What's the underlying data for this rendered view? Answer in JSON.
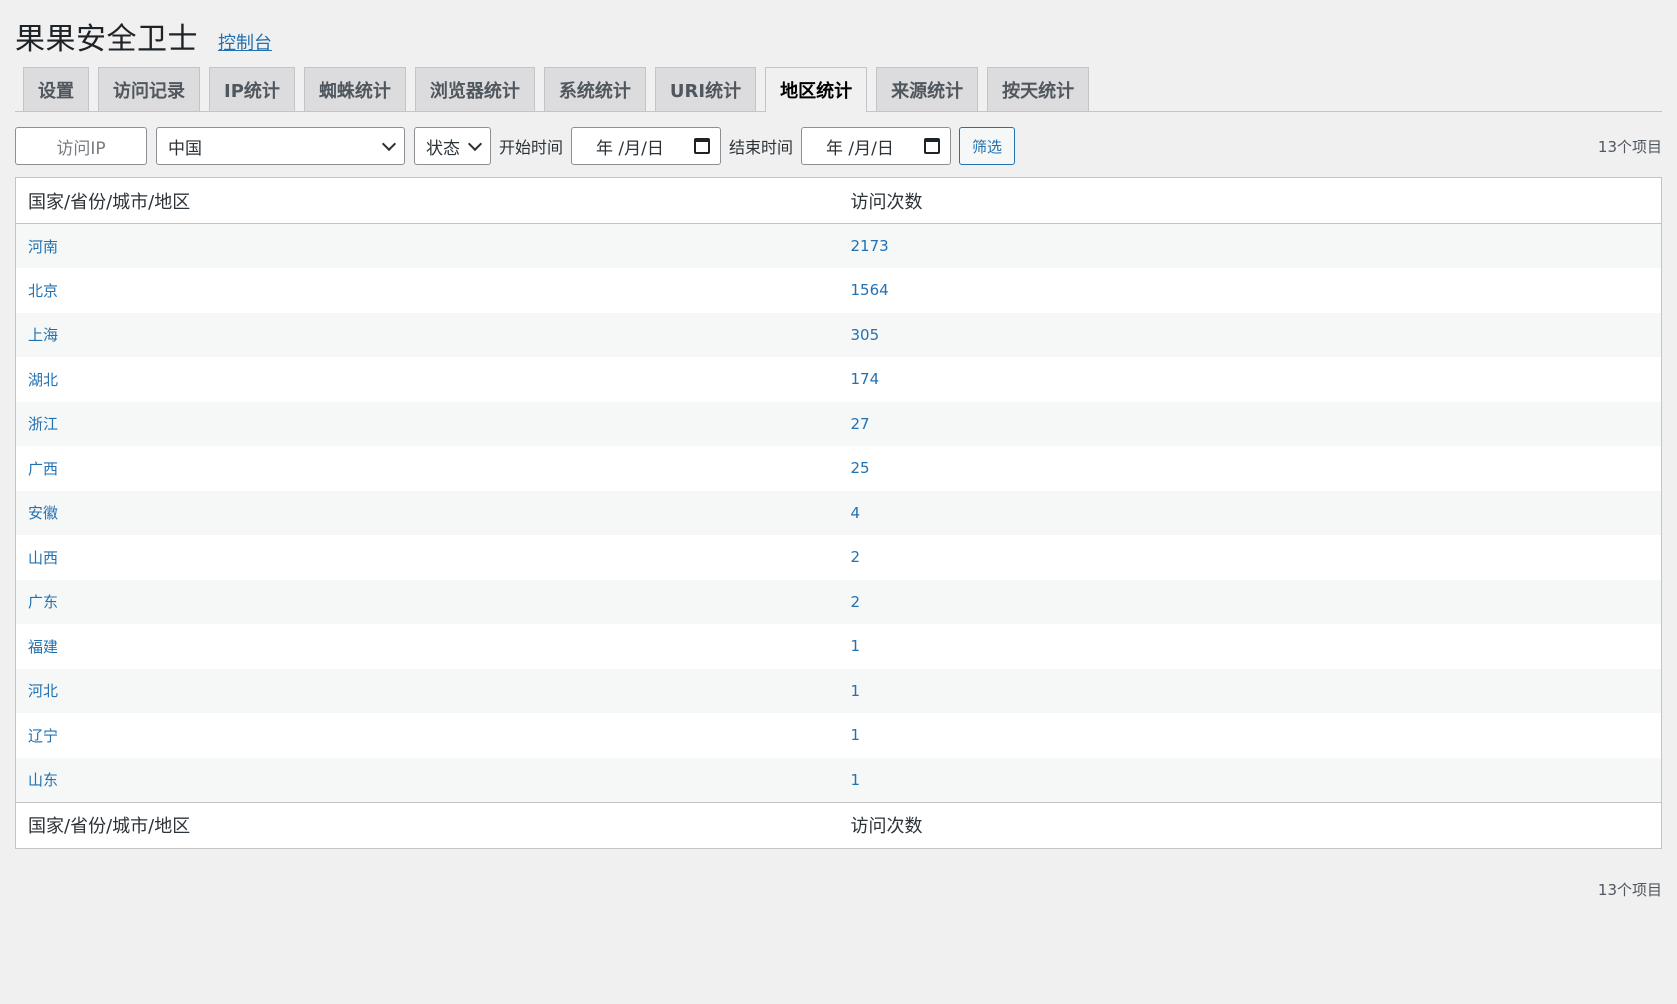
{
  "header": {
    "title": "果果安全卫士",
    "console_link": "控制台"
  },
  "tabs": [
    {
      "label": "设置",
      "active": false
    },
    {
      "label": "访问记录",
      "active": false
    },
    {
      "label": "IP统计",
      "active": false
    },
    {
      "label": "蜘蛛统计",
      "active": false
    },
    {
      "label": "浏览器统计",
      "active": false
    },
    {
      "label": "系统统计",
      "active": false
    },
    {
      "label": "URI统计",
      "active": false
    },
    {
      "label": "地区统计",
      "active": true
    },
    {
      "label": "来源统计",
      "active": false
    },
    {
      "label": "按天统计",
      "active": false
    }
  ],
  "filters": {
    "ip_placeholder": "访问IP",
    "country_value": "中国",
    "status_value": "状态",
    "start_label": "开始时间",
    "start_value": "年 /月/日",
    "end_label": "结束时间",
    "end_value": "年 /月/日",
    "filter_button": "筛选"
  },
  "item_count": "13个项目",
  "table": {
    "columns": [
      "国家/省份/城市/地区",
      "访问次数"
    ],
    "rows": [
      [
        "河南",
        "2173"
      ],
      [
        "北京",
        "1564"
      ],
      [
        "上海",
        "305"
      ],
      [
        "湖北",
        "174"
      ],
      [
        "浙江",
        "27"
      ],
      [
        "广西",
        "25"
      ],
      [
        "安徽",
        "4"
      ],
      [
        "山西",
        "2"
      ],
      [
        "广东",
        "2"
      ],
      [
        "福建",
        "1"
      ],
      [
        "河北",
        "1"
      ],
      [
        "辽宁",
        "1"
      ],
      [
        "山东",
        "1"
      ]
    ]
  }
}
